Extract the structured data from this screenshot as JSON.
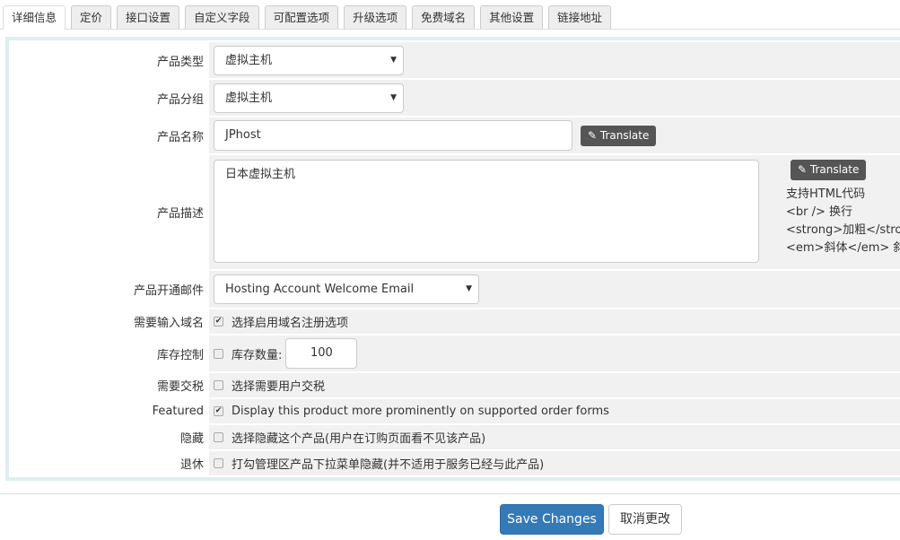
{
  "tabs": [
    "详细信息",
    "定价",
    "接口设置",
    "自定义字段",
    "可配置选项",
    "升级选项",
    "免费域名",
    "其他设置",
    "链接地址"
  ],
  "form": {
    "type": {
      "label": "产品类型",
      "value": "虚拟主机"
    },
    "group": {
      "label": "产品分组",
      "value": "虚拟主机"
    },
    "name": {
      "label": "产品名称",
      "value": "JPhost",
      "translate": "Translate"
    },
    "desc": {
      "label": "产品描述",
      "value": "日本虚拟主机",
      "translate": "Translate",
      "help": [
        "支持HTML代码",
        "<br /> 换行",
        "<strong>加粗</strong>",
        "<em>斜体</em> 斜体"
      ]
    },
    "email": {
      "label": "产品开通邮件",
      "value": "Hosting Account Welcome Email"
    },
    "domain": {
      "label": "需要输入域名",
      "text": "选择启用域名注册选项",
      "checked": true
    },
    "stock": {
      "label": "库存控制",
      "text": "库存数量:",
      "value": "100",
      "checked": false
    },
    "tax": {
      "label": "需要交税",
      "text": "选择需要用户交税",
      "checked": false
    },
    "featured": {
      "label": "Featured",
      "text": "Display this product more prominently on supported order forms",
      "checked": true
    },
    "hidden": {
      "label": "隐藏",
      "text": "选择隐藏这个产品(用户在订购页面看不见该产品)",
      "checked": false
    },
    "retired": {
      "label": "退休",
      "text": "打勾管理区产品下拉菜单隐藏(并不适用于服务已经与此产品)",
      "checked": false
    }
  },
  "buttons": {
    "save": "Save Changes",
    "cancel": "取消更改"
  }
}
